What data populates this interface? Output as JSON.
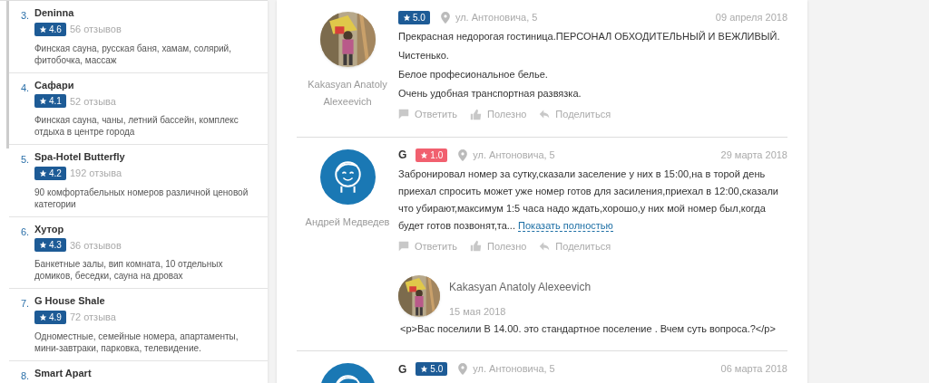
{
  "sidebar": {
    "items": [
      {
        "number": "3.",
        "name": "Deninna",
        "rating": "4.6",
        "reviews": "56 отзывов",
        "description": "Финская сауна, русская баня, хамам, солярий, фитобочка, массаж"
      },
      {
        "number": "4.",
        "name": "Сафари",
        "rating": "4.1",
        "reviews": "52 отзыва",
        "description": "Финская сауна, чаны, летний бассейн, комплекс отдыха в центре города"
      },
      {
        "number": "5.",
        "name": "Spa-Hotel Butterfly",
        "rating": "4.2",
        "reviews": "192 отзыва",
        "description": "90 комфортабельных номеров различной ценовой категории"
      },
      {
        "number": "6.",
        "name": "Хутор",
        "rating": "4.3",
        "reviews": "36 отзывов",
        "description": "Банкетные залы, вип комната, 10 отдельных домиков, беседки, сауна на дровах"
      },
      {
        "number": "7.",
        "name": "G House Shale",
        "rating": "4.9",
        "reviews": "72 отзыва",
        "description": "Одноместные, семейные номера, апартаменты, мини-завтраки, парковка, телевидение."
      },
      {
        "number": "8.",
        "name": "Smart Apart"
      }
    ]
  },
  "reviews": [
    {
      "avatar": {
        "kind": "picture"
      },
      "author": "Kakasyan Anatoly Alexeevich",
      "rating": "5.0",
      "color": "#1d5b96",
      "address": "ул. Антоновича, 5",
      "date": "09 апреля 2018",
      "paragraphs": [
        "Прекрасная недорогая гостиница.ПЕРСОНАЛ ОБХОДИТЕЛЬНЫЙ И ВЕЖЛИВЫЙ.",
        "Чистенько.",
        "Белое професиональное белье.",
        "Очень удобная транспортная развязка."
      ],
      "actions": [
        "Ответить",
        "Полезно",
        "Поделиться"
      ]
    },
    {
      "avatar": {
        "kind": "icon"
      },
      "author": "Андрей Медведев",
      "source": "G",
      "rating": "1.0",
      "color": "#f1606f",
      "address": "ул. Антоновича, 5",
      "date": "29 марта 2018",
      "paragraphs": [
        "Забронировал номер за сутку,сказали заселение у них в 15:00,на в торой день приехал спросить может уже номер готов для засиления,приехал в 12:00,сказали что убирают,максимум 1:5 часа надо ждать,хорошо,у них мой номер был,когда будет готов позвонят,та..."
      ],
      "more_link": "Показать полностью",
      "actions": [
        "Ответить",
        "Полезно",
        "Поделиться"
      ],
      "reply": {
        "avatar": {
          "kind": "picture"
        },
        "author": "Kakasyan Anatoly Alexeevich",
        "date": "15 мая 2018",
        "text": "<p>Вас поселили В 14.00. это стандартное поселение . Вчем суть вопроса.?</p>"
      }
    },
    {
      "avatar": {
        "kind": "icon"
      },
      "source": "G",
      "rating": "5.0",
      "color": "#1d5b96",
      "address": "ул. Антоновича, 5",
      "date": "06 марта 2018"
    }
  ]
}
